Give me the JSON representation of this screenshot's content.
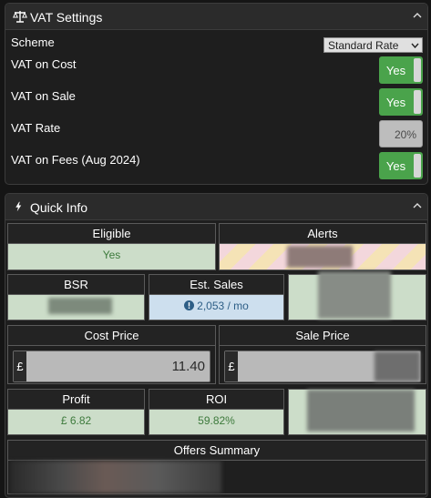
{
  "vat_panel": {
    "title": "VAT Settings",
    "scheme_label": "Scheme",
    "scheme_value": "Standard Rate",
    "vat_on_cost_label": "VAT on Cost",
    "vat_on_cost_value": "Yes",
    "vat_on_sale_label": "VAT on Sale",
    "vat_on_sale_value": "Yes",
    "vat_rate_label": "VAT Rate",
    "vat_rate_value": "20%",
    "vat_on_fees_label": "VAT on Fees (Aug 2024)",
    "vat_on_fees_value": "Yes"
  },
  "quick_info": {
    "title": "Quick Info",
    "eligible_label": "Eligible",
    "eligible_value": "Yes",
    "alerts_label": "Alerts",
    "bsr_label": "BSR",
    "est_sales_label": "Est. Sales",
    "est_sales_value": "2,053 / mo",
    "cost_price_label": "Cost Price",
    "cost_price_currency": "£",
    "cost_price_value": "11.40",
    "sale_price_label": "Sale Price",
    "sale_price_currency": "£",
    "profit_label": "Profit",
    "profit_value": "£ 6.82",
    "roi_label": "ROI",
    "roi_value": "59.82%",
    "offers_summary_label": "Offers Summary"
  },
  "icons": {
    "vat_header": "scales-icon",
    "quick_info_header": "lightning-icon",
    "collapse": "chevron-up-icon",
    "select_caret": "chevron-down-icon",
    "info": "info-icon"
  },
  "colors": {
    "toggle_on": "#4aa34b",
    "positive_bg": "#ccddc9",
    "info_bg": "#cddfee"
  }
}
